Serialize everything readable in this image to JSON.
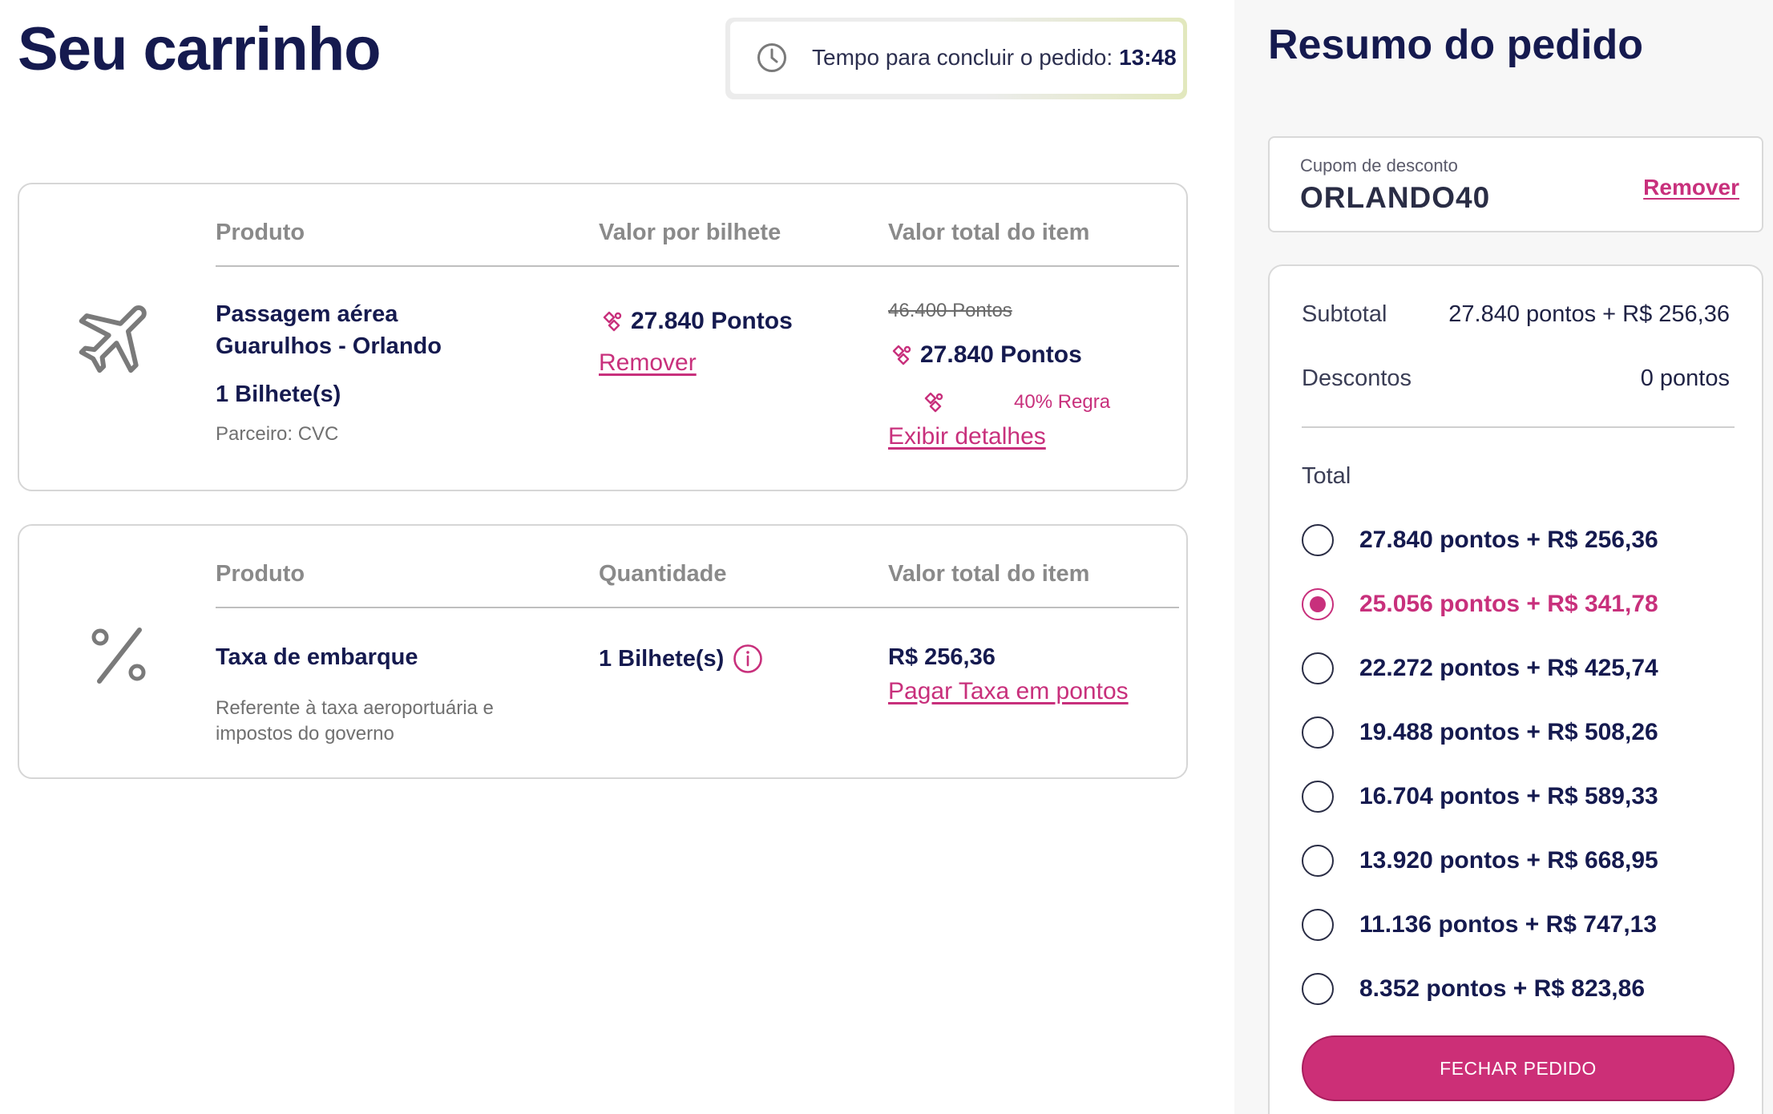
{
  "cart": {
    "title": "Seu carrinho",
    "timer": {
      "label": "Tempo para concluir o pedido:",
      "value": "13:48"
    }
  },
  "item_flight": {
    "headers": {
      "product": "Produto",
      "unit_price": "Valor por bilhete",
      "total": "Valor total do item"
    },
    "name_line1": "Passagem aérea",
    "name_line2": "Guarulhos - Orlando",
    "tickets": "1 Bilhete(s)",
    "partner": "Parceiro: CVC",
    "unit_points": "27.840 Pontos",
    "remove_label": "Remover",
    "original_points": "46.400 Pontos",
    "total_points": "27.840 Pontos",
    "rule_label": "40% Regra",
    "details_label": "Exibir detalhes",
    "icon": "airplane-icon"
  },
  "item_tax": {
    "headers": {
      "product": "Produto",
      "quantity": "Quantidade",
      "total": "Valor total do item"
    },
    "name": "Taxa de embarque",
    "description_line1": "Referente à taxa aeroportuária e",
    "description_line2": "impostos do governo",
    "quantity": "1 Bilhete(s)",
    "total": "R$ 256,36",
    "pay_points_label": "Pagar Taxa em pontos",
    "icon": "percent-icon"
  },
  "summary": {
    "title": "Resumo do pedido",
    "coupon": {
      "label": "Cupom de desconto",
      "code": "ORLANDO40",
      "remove_label": "Remover"
    },
    "subtotal_label": "Subtotal",
    "subtotal_value": "27.840 pontos + R$ 256,36",
    "discounts_label": "Descontos",
    "discounts_value": "0 pontos",
    "total_label": "Total",
    "options": [
      {
        "label": "27.840 pontos + R$ 256,36",
        "selected": false
      },
      {
        "label": "25.056 pontos + R$ 341,78",
        "selected": true
      },
      {
        "label": "22.272 pontos + R$ 425,74",
        "selected": false
      },
      {
        "label": "19.488 pontos + R$ 508,26",
        "selected": false
      },
      {
        "label": "16.704 pontos + R$ 589,33",
        "selected": false
      },
      {
        "label": "13.920 pontos + R$ 668,95",
        "selected": false
      },
      {
        "label": "11.136 pontos + R$ 747,13",
        "selected": false
      },
      {
        "label": "8.352 pontos + R$ 823,86",
        "selected": false
      }
    ],
    "cta_label": "FECHAR PEDIDO"
  },
  "colors": {
    "navy": "#151a4f",
    "accent": "#c8307c",
    "cta": "#cc2f77",
    "muted": "#8a8a8a"
  }
}
